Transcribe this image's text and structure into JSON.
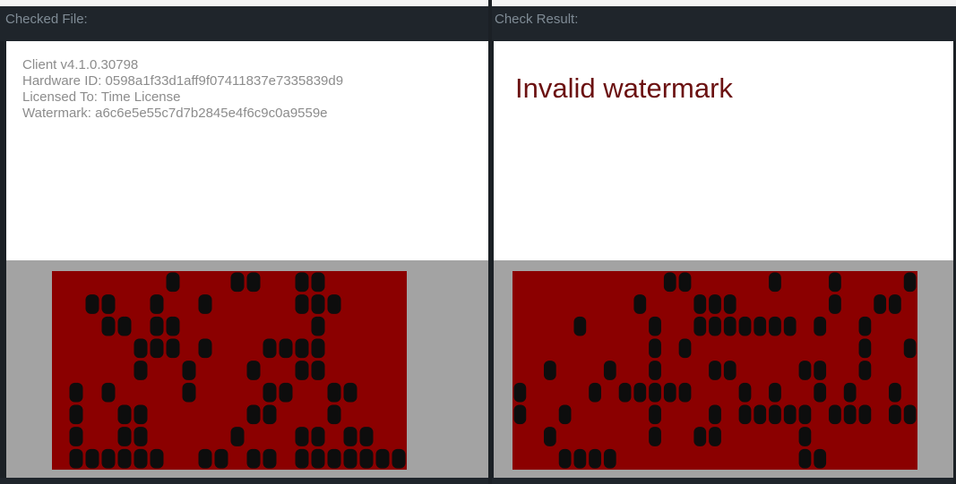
{
  "checked_file": {
    "header": "Checked File:",
    "lines": [
      "Client v4.1.0.30798",
      "Hardware ID: 0598a1f33d1aff9f07411837e7335839d9",
      "Licensed To: Time License",
      "Watermark: a6c6e5e55c7d7b2845e4f6c9c0a9559e"
    ],
    "matrix": {
      "background_color": "#8b0000",
      "dot_color": "#0d0d0d",
      "rows": [
        "0000000100011001100000",
        "0011001001000001110000",
        "0001101100000000100000",
        "0000011101000111100000",
        "0000010010001001100000",
        "0101000010000110011000",
        "0100110000001100010000",
        "0100110000010001101100",
        "0111111001101101111111"
      ]
    }
  },
  "check_result": {
    "header": "Check Result:",
    "status_text": "Invalid watermark",
    "status_color": "#6b1111",
    "matrix": {
      "background_color": "#8b0000",
      "dot_color": "#0d0d0d",
      "rows": [
        "000000000011000001000100001",
        "000000001000111000000100110",
        "000010000100111111101001000",
        "000000000101000000000001001",
        "001000100100011000011001000",
        "100001011111000101001010010",
        "100100000100010111110111011",
        "001000000100110000010000000",
        "000111100000000000011000000"
      ]
    }
  }
}
